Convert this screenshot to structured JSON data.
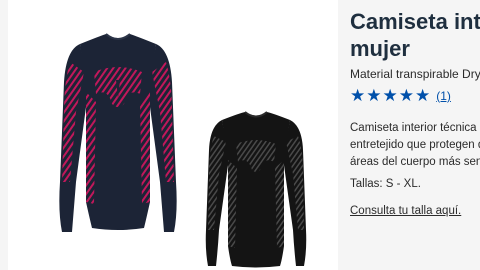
{
  "product": {
    "title_line1": "Camiseta inter",
    "title_line2": "mujer",
    "subtitle": "Material transpirable DryAct",
    "rating": {
      "stars": 5,
      "count_label": "(1)",
      "star_color": "#0050aa"
    },
    "description": [
      "Camiseta interior técnica pa",
      "entretejido que protegen de",
      "áreas del cuerpo más sensib"
    ],
    "sizes": "Tallas: S - XL.",
    "size_link": "Consulta tu talla aquí."
  },
  "gallery": {
    "images": [
      {
        "icon": "navy-pink-longsleeve-shirt",
        "body_color": "#1c2436",
        "accent_color": "#c2185b"
      },
      {
        "icon": "black-longsleeve-shirt",
        "body_color": "#141414",
        "accent_color": "#4a4a4a"
      }
    ]
  }
}
